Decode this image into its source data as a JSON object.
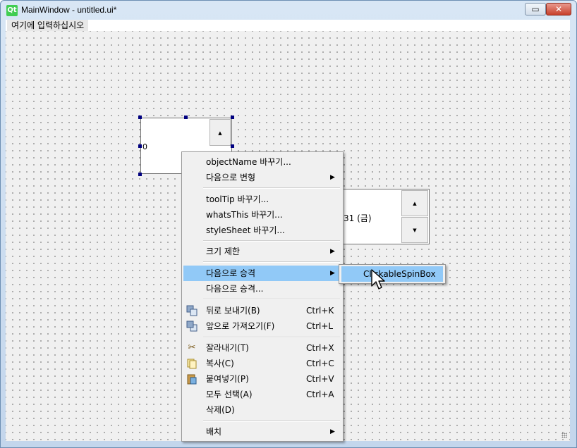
{
  "window": {
    "title": "MainWindow - untitled.ui*",
    "app_icon": "qt-icon",
    "minimize_label": "▭",
    "close_label": "✕"
  },
  "menubar": {
    "placeholder_item": "여기에 입력하십시오"
  },
  "widgets": {
    "spinbox_value": "0",
    "date_spinbox_value": "/31 (금)"
  },
  "context_menu": {
    "items": [
      {
        "label": "objectName 바꾸기..."
      },
      {
        "label": "다음으로 변형",
        "submenu": true
      },
      {
        "label": "toolTip 바꾸기..."
      },
      {
        "label": "whatsThis 바꾸기..."
      },
      {
        "label": "styleSheet 바꾸기..."
      },
      {
        "label": "크기 제한",
        "submenu": true
      },
      {
        "label": "다음으로 승격",
        "submenu": true,
        "highlighted": true
      },
      {
        "label": "다음으로 승격..."
      },
      {
        "label": "뒤로 보내기(B)",
        "shortcut": "Ctrl+K",
        "icon": "send-back-icon"
      },
      {
        "label": "앞으로 가져오기(F)",
        "shortcut": "Ctrl+L",
        "icon": "bring-front-icon"
      },
      {
        "label": "잘라내기(T)",
        "shortcut": "Ctrl+X",
        "icon": "scissors-icon"
      },
      {
        "label": "복사(C)",
        "shortcut": "Ctrl+C",
        "icon": "copy-icon"
      },
      {
        "label": "붙여넣기(P)",
        "shortcut": "Ctrl+V",
        "icon": "paste-icon"
      },
      {
        "label": "모두 선택(A)",
        "shortcut": "Ctrl+A"
      },
      {
        "label": "삭제(D)"
      },
      {
        "label": "배치",
        "submenu": true
      }
    ]
  },
  "submenu": {
    "items": [
      {
        "label": "ClickableSpinBox",
        "highlighted": true
      }
    ]
  },
  "colors": {
    "highlight": "#91c9f7",
    "selection_handle": "#000080",
    "qt_green": "#41cd52"
  }
}
